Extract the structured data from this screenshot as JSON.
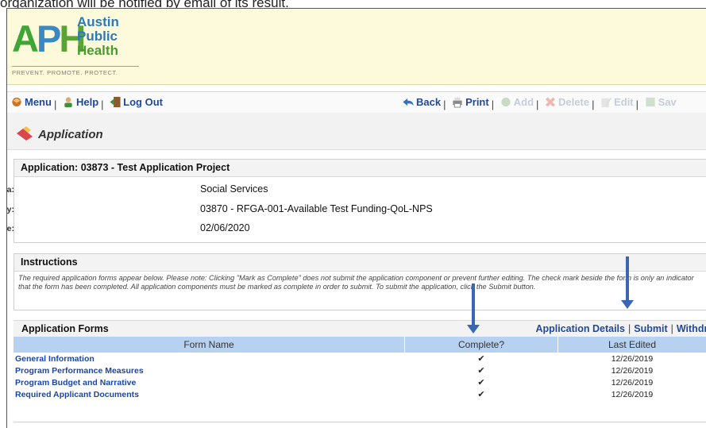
{
  "caption": "organization will be notified by email of its result.",
  "logo": {
    "letters": [
      "A",
      "P",
      "H"
    ],
    "name_lines": [
      "Austin",
      "Public",
      "Health"
    ],
    "tagline": "PREVENT. PROMOTE. PROTECT."
  },
  "toolbar": {
    "left": [
      {
        "label": "Menu",
        "icon": "menu-icon"
      },
      {
        "label": "Help",
        "icon": "help-icon"
      },
      {
        "label": "Log Out",
        "icon": "logout-icon"
      }
    ],
    "right": [
      {
        "label": "Back",
        "icon": "back-icon",
        "enabled": true
      },
      {
        "label": "Print",
        "icon": "print-icon",
        "enabled": true
      },
      {
        "label": "Add",
        "icon": "add-icon",
        "enabled": false
      },
      {
        "label": "Delete",
        "icon": "delete-icon",
        "enabled": false
      },
      {
        "label": "Edit",
        "icon": "edit-icon",
        "enabled": false
      },
      {
        "label": "Sav",
        "icon": "save-icon",
        "enabled": false
      }
    ]
  },
  "page_title": "Application",
  "application": {
    "header": "Application: 03873 - Test Application Project",
    "fields": [
      {
        "label": "Program Area:",
        "value": "Social Services"
      },
      {
        "label": "Opportunity:",
        "value": "03870 - RFGA-001-Available Test Funding-QoL-NPS"
      },
      {
        "label": "Application Deadline:",
        "value": "02/06/2020"
      }
    ]
  },
  "instructions": {
    "header": "Instructions",
    "text": "The required application forms appear below. Please note: Clicking \"Mark as Complete\" does not submit the application component or prevent further editing. The check mark beside the form is only an indicator that the form has been completed. All application components must be marked as complete in order to submit. To submit the application, click the Submit button."
  },
  "forms": {
    "header": "Application Forms",
    "links": [
      "Application Details",
      "Submit",
      "Withdraw"
    ],
    "columns": [
      "Form Name",
      "Complete?",
      "Last Edited"
    ],
    "rows": [
      {
        "name": "General Information",
        "complete": "✔",
        "last_edited": "12/26/2019"
      },
      {
        "name": "Program Performance Measures",
        "complete": "✔",
        "last_edited": "12/26/2019"
      },
      {
        "name": "Program Budget and Narrative",
        "complete": "✔",
        "last_edited": "12/26/2019"
      },
      {
        "name": "Required Applicant Documents",
        "complete": "✔",
        "last_edited": "12/26/2019"
      }
    ]
  },
  "colors": {
    "link": "#22489a",
    "header_bg": "#fdfadb",
    "table_header": "#b7d1f0",
    "arrow": "#3a66b6"
  }
}
